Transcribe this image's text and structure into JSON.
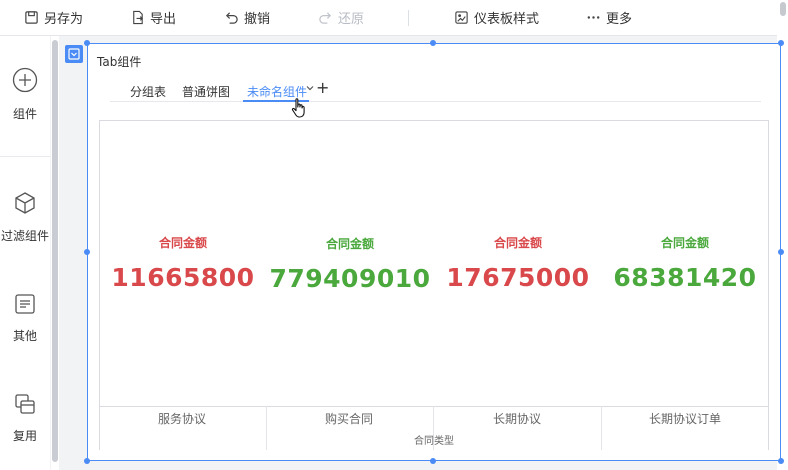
{
  "toolbar": {
    "save_as": "另存为",
    "export": "导出",
    "undo": "撤销",
    "redo": "还原",
    "dashboard_style": "仪表板样式",
    "more": "更多"
  },
  "sidebar": {
    "items": [
      {
        "label": "组件",
        "icon": "plus-circle-icon"
      },
      {
        "label": "过滤组件",
        "icon": "cube-icon"
      },
      {
        "label": "其他",
        "icon": "document-icon"
      },
      {
        "label": "复用",
        "icon": "reuse-icon"
      }
    ]
  },
  "widget": {
    "title": "Tab组件",
    "tabs": [
      {
        "label": "分组表",
        "active": false
      },
      {
        "label": "普通饼图",
        "active": false
      },
      {
        "label": "未命名组件",
        "active": true
      }
    ],
    "add_tab": "+"
  },
  "chart": {
    "metrics": [
      {
        "label": "合同金额",
        "value": "11665800",
        "color": "#d9484b"
      },
      {
        "label": "合同金额",
        "value": "779409010",
        "color": "#4aa83c"
      },
      {
        "label": "合同金额",
        "value": "17675000",
        "color": "#d9484b"
      },
      {
        "label": "合同金额",
        "value": "68381420",
        "color": "#4aa83c"
      }
    ],
    "categories": [
      "服务协议",
      "购买合同",
      "长期协议",
      "长期协议订单"
    ],
    "x_axis_title": "合同类型"
  },
  "colors": {
    "accent": "#4a8bf5",
    "red": "#d9484b",
    "green": "#4aa83c"
  }
}
